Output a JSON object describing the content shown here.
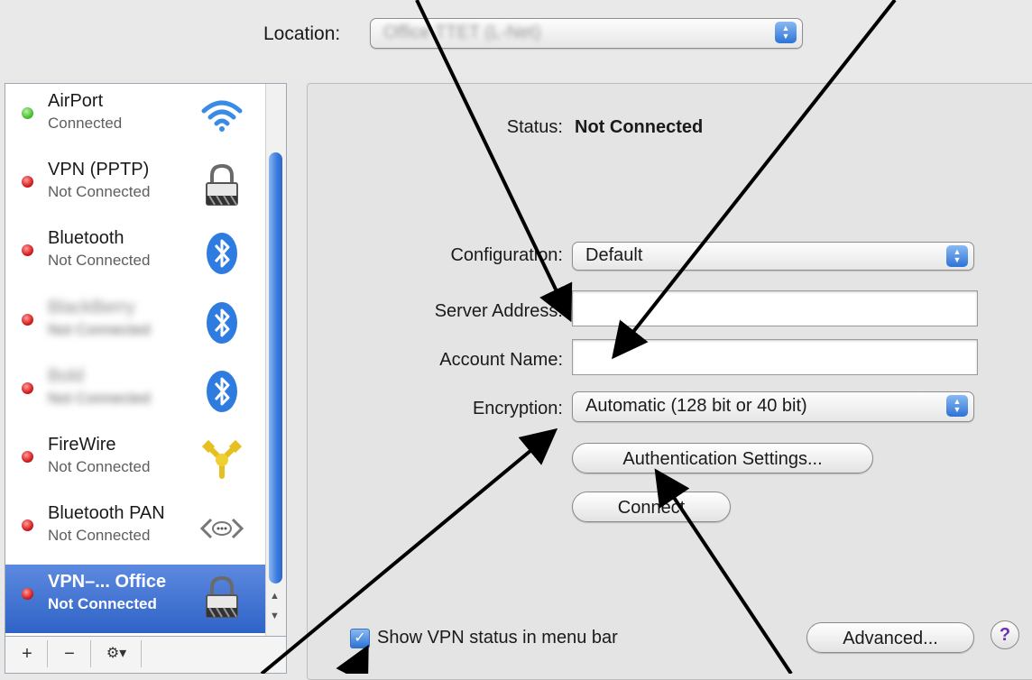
{
  "toolbar": {
    "location_label": "Location:",
    "location_value": "Office TTET (L-Net)"
  },
  "sidebar": {
    "services": [
      {
        "name": "AirPort",
        "status": "Connected",
        "dot": "green",
        "icon": "wifi-icon"
      },
      {
        "name": "VPN (PPTP)",
        "status": "Not Connected",
        "dot": "red",
        "icon": "lock-icon"
      },
      {
        "name": "Bluetooth",
        "status": "Not Connected",
        "dot": "red",
        "icon": "bluetooth-icon"
      },
      {
        "name": "BlackBerry",
        "status": "Not Connected",
        "dot": "red",
        "icon": "bluetooth-icon"
      },
      {
        "name": "Bold",
        "status": "Not Connected",
        "dot": "red",
        "icon": "bluetooth-icon"
      },
      {
        "name": "FireWire",
        "status": "Not Connected",
        "dot": "red",
        "icon": "firewire-icon"
      },
      {
        "name": "Bluetooth PAN",
        "status": "Not Connected",
        "dot": "red",
        "icon": "pan-icon"
      },
      {
        "name": "VPN–... Office",
        "status": "Not Connected",
        "dot": "red",
        "icon": "lock-icon",
        "selected": true
      }
    ],
    "tools": {
      "add": "+",
      "remove": "−",
      "gear": "⚙▾"
    }
  },
  "main": {
    "status_label": "Status:",
    "status_value": "Not Connected",
    "configuration_label": "Configuration:",
    "configuration_value": "Default",
    "server_address_label": "Server Address:",
    "server_address_value": "",
    "account_name_label": "Account Name:",
    "account_name_value": "",
    "encryption_label": "Encryption:",
    "encryption_value": "Automatic (128 bit or 40 bit)",
    "auth_button": "Authentication Settings...",
    "connect_button": "Connect",
    "show_status_label": "Show VPN status in menu bar",
    "show_status_checked": true,
    "advanced_button": "Advanced...",
    "help_button": "?"
  },
  "colors": {
    "selection": "#3a6fd0",
    "status_green": "#4cbf33",
    "status_red": "#d61e1e",
    "accent_blue": "#2c73d6"
  }
}
